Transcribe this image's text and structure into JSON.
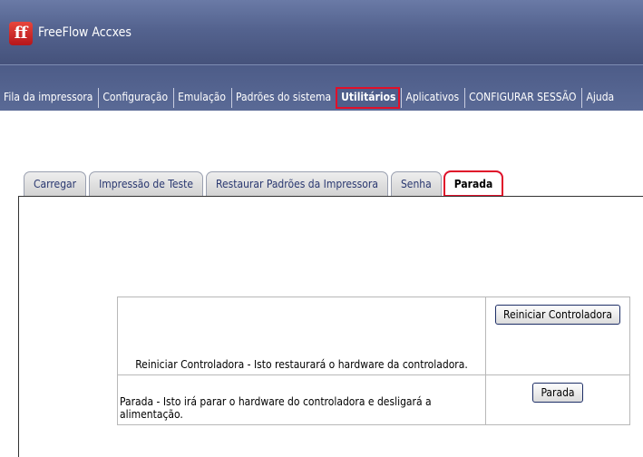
{
  "app": {
    "title": "FreeFlow Accxes",
    "logo_glyph": "ff"
  },
  "colors": {
    "titlebar": "#54638f",
    "highlight": "#e0102a",
    "tab_text": "#2a3870"
  },
  "menu": {
    "items": [
      {
        "label": "Fila da impressora"
      },
      {
        "label": "Configuração"
      },
      {
        "label": "Emulação"
      },
      {
        "label": "Padrões do sistema"
      },
      {
        "label": "Utilitários",
        "selected": true
      },
      {
        "label": "Aplicativos"
      },
      {
        "label": "CONFIGURAR SESSÃO"
      },
      {
        "label": "Ajuda"
      }
    ]
  },
  "subtabs": {
    "items": [
      {
        "label": "Carregar"
      },
      {
        "label": "Impressão de Teste"
      },
      {
        "label": "Restaurar Padrões da Impressora"
      },
      {
        "label": "Senha"
      },
      {
        "label": "Parada",
        "selected": true
      }
    ]
  },
  "actions": {
    "restart": {
      "description": "Reiniciar Controladora - Isto restaurará o hardware da controladora.",
      "button": "Reiniciar Controladora"
    },
    "shutdown": {
      "description": "Parada - Isto irá parar o hardware do controladora e desligará a alimentação.",
      "button": "Parada"
    }
  }
}
